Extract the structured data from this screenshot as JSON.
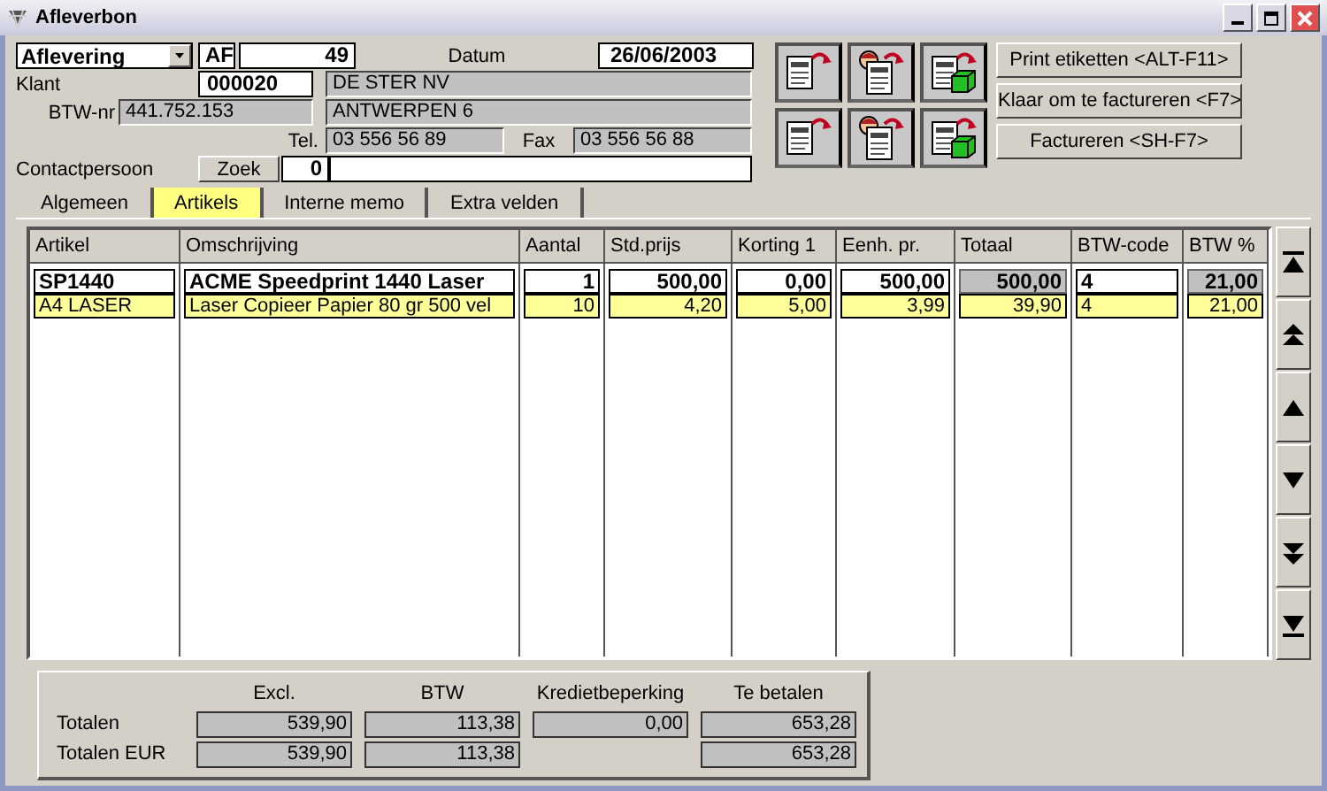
{
  "window": {
    "title": "Afleverbon"
  },
  "header": {
    "doc_type": "Aflevering",
    "prefix": "AF",
    "number": "49",
    "date_label": "Datum",
    "date": "26/06/2003",
    "customer_label": "Klant",
    "customer_code": "000020",
    "customer_name": "DE STER NV",
    "vat_label": "BTW-nr",
    "vat_number": "441.752.153",
    "address": "ANTWERPEN 6",
    "tel_label": "Tel.",
    "tel": "03 556 56 89",
    "fax_label": "Fax",
    "fax": "03 556 56 88",
    "contact_label": "Contactpersoon",
    "search_button": "Zoek",
    "contact_number": "0"
  },
  "buttons": [
    "Print etiketten <ALT-F11>",
    "Klaar om te factureren <F7>",
    "Factureren <SH-F7>"
  ],
  "tabs": [
    {
      "label": "Algemeen",
      "selected": false
    },
    {
      "label": "Artikels",
      "selected": true
    },
    {
      "label": "Interne memo",
      "selected": false
    },
    {
      "label": "Extra velden",
      "selected": false
    }
  ],
  "table": {
    "columns": [
      {
        "label": "Artikel",
        "kind": "text",
        "readonly": false
      },
      {
        "label": "Omschrijving",
        "kind": "text",
        "readonly": false
      },
      {
        "label": "Aantal",
        "kind": "number",
        "readonly": false
      },
      {
        "label": "Std.prijs",
        "kind": "number",
        "readonly": false
      },
      {
        "label": "Korting 1",
        "kind": "number",
        "readonly": false
      },
      {
        "label": "Eenh. pr.",
        "kind": "number",
        "readonly": false
      },
      {
        "label": "Totaal",
        "kind": "number",
        "readonly": true
      },
      {
        "label": "BTW-code",
        "kind": "text",
        "readonly": false
      },
      {
        "label": "BTW %",
        "kind": "number",
        "readonly": true
      }
    ],
    "rows": [
      {
        "selected": false,
        "bold": true,
        "cells": [
          "SP1440",
          "ACME Speedprint 1440 Laser",
          "1",
          "500,00",
          "0,00",
          "500,00",
          "500,00",
          "4",
          "21,00"
        ]
      },
      {
        "selected": true,
        "bold": false,
        "cells": [
          "A4 LASER",
          "Laser Copieer Papier 80 gr 500 vel",
          "10",
          "4,20",
          "5,00",
          "3,99",
          "39,90",
          "4",
          "21,00"
        ]
      }
    ]
  },
  "totals": {
    "columns": [
      "Excl.",
      "BTW",
      "Kredietbeperking",
      "Te betalen"
    ],
    "rows": [
      {
        "label": "Totalen",
        "excl": "539,90",
        "vat": "113,38",
        "credit_limit": "0,00",
        "to_pay": "653,28"
      },
      {
        "label": "Totalen EUR",
        "excl": "539,90",
        "vat": "113,38",
        "to_pay": "653,28"
      }
    ]
  }
}
